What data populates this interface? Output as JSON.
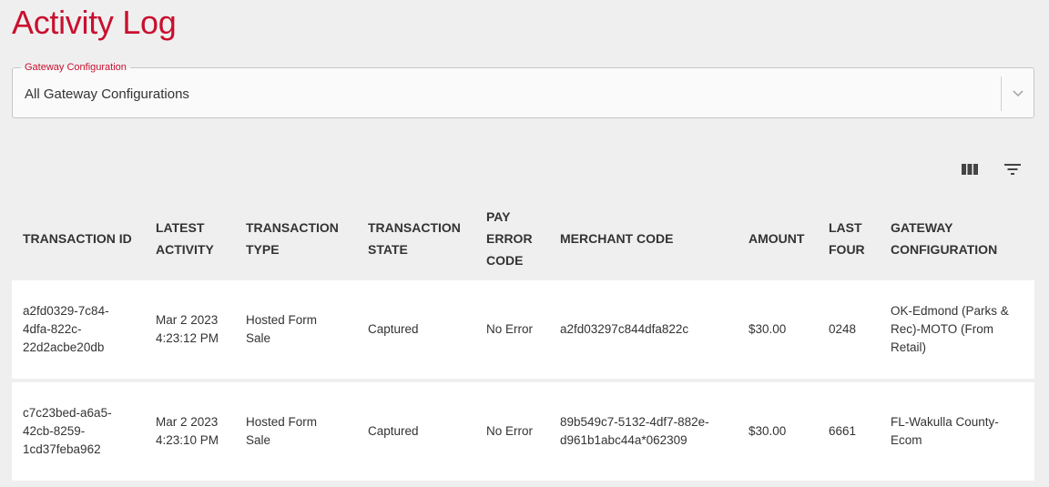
{
  "page": {
    "title": "Activity Log"
  },
  "gateway_filter": {
    "label": "Gateway Configuration",
    "value": "All Gateway Configurations"
  },
  "toolbar": {
    "columns_icon": "columns-icon",
    "filter_icon": "filter-icon"
  },
  "colors": {
    "accent": "#c8102e",
    "background": "#efefef",
    "row_bg": "#ffffff"
  },
  "table": {
    "headers": [
      "TRANSACTION ID",
      "LATEST\nACTIVITY",
      "TRANSACTION\nTYPE",
      "TRANSACTION\nSTATE",
      "PAY\nERROR\nCODE",
      "MERCHANT CODE",
      "AMOUNT",
      "LAST\nFOUR",
      "GATEWAY\nCONFIGURATION"
    ],
    "rows": [
      {
        "transaction_id": "a2fd0329-7c84-\n4dfa-822c-\n22d2acbe20db",
        "latest_activity": "Mar 2 2023\n4:23:12 PM",
        "transaction_type": "Hosted Form\nSale",
        "transaction_state": "Captured",
        "pay_error_code": "No Error",
        "merchant_code": "a2fd03297c844dfa822c",
        "amount": "$30.00",
        "last_four": "0248",
        "gateway_configuration": "OK-Edmond (Parks &\nRec)-MOTO (From\nRetail)"
      },
      {
        "transaction_id": "c7c23bed-a6a5-\n42cb-8259-\n1cd37feba962",
        "latest_activity": "Mar 2 2023\n4:23:10 PM",
        "transaction_type": "Hosted Form\nSale",
        "transaction_state": "Captured",
        "pay_error_code": "No Error",
        "merchant_code": "89b549c7-5132-4df7-882e-\nd961b1abc44a*062309",
        "amount": "$30.00",
        "last_four": "6661",
        "gateway_configuration": "FL-Wakulla County-\nEcom"
      }
    ]
  }
}
